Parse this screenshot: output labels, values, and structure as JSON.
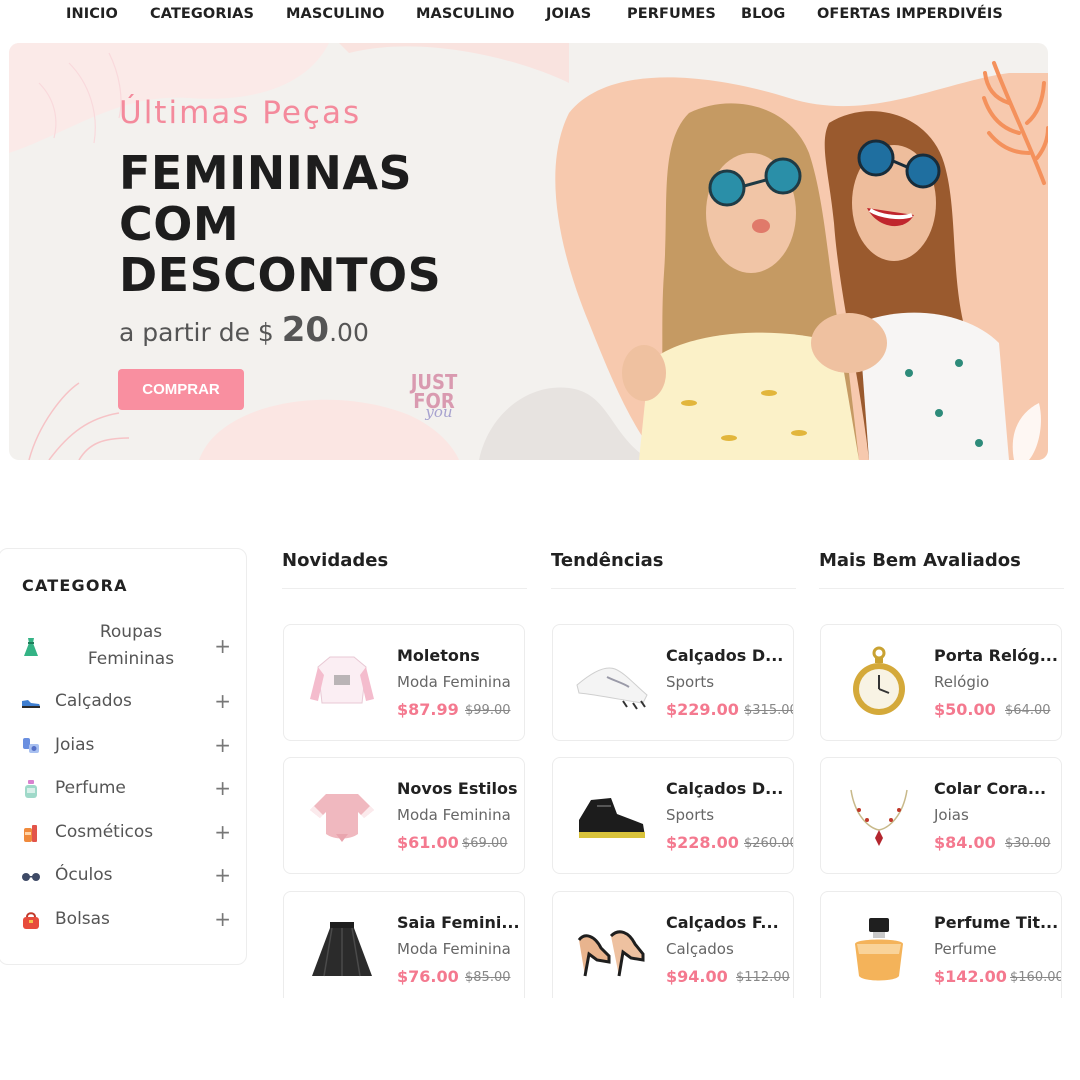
{
  "nav": {
    "items": [
      "INICIO",
      "CATEGORIAS",
      "MASCULINO",
      "MASCULINO",
      "JOIAS",
      "PERFUMES",
      "BLOG",
      "OFERTAS IMPERDIVÉIS"
    ]
  },
  "hero": {
    "subtitle": "Últimas Peças",
    "title_lines": [
      "FEMININAS",
      "COM",
      "DESCONTOS"
    ],
    "price_prefix": "a partir de $",
    "price_amount": "20",
    "price_cents": ".00",
    "button_label": "COMPRAR",
    "stamp_line1": "JUST",
    "stamp_line2": "FOR",
    "stamp_line3": "you"
  },
  "sidebar": {
    "title": "CATEGORA",
    "items": [
      {
        "label": "Roupas Femininas",
        "icon": "dress-icon"
      },
      {
        "label": "Calçados",
        "icon": "shoe-icon"
      },
      {
        "label": "Joias",
        "icon": "watch-icon"
      },
      {
        "label": "Perfume",
        "icon": "perfume-icon"
      },
      {
        "label": "Cosméticos",
        "icon": "cosmetics-icon"
      },
      {
        "label": "Óculos",
        "icon": "glasses-icon"
      },
      {
        "label": "Bolsas",
        "icon": "bag-icon"
      }
    ],
    "expand_symbol": "+"
  },
  "columns": [
    {
      "title": "Novidades",
      "products": [
        {
          "name": "Moletons",
          "category": "Moda Feminina",
          "price": "$87.99",
          "old_price": "$99.00",
          "image": "sweatshirt"
        },
        {
          "name": "Novos Estilos",
          "category": "Moda Feminina",
          "price": "$61.00",
          "old_price": "$69.00",
          "image": "crop-top"
        },
        {
          "name": "Saia Femini...",
          "category": "Moda Feminina",
          "price": "$76.00",
          "old_price": "$85.00",
          "image": "skirt"
        }
      ]
    },
    {
      "title": "Tendências",
      "products": [
        {
          "name": "Calçados D...",
          "category": "Sports",
          "price": "$229.00",
          "old_price": "$315.00",
          "image": "sneaker-white"
        },
        {
          "name": "Calçados D...",
          "category": "Sports",
          "price": "$228.00",
          "old_price": "$260.00",
          "image": "sneaker-black"
        },
        {
          "name": "Calçados F...",
          "category": "Calçados",
          "price": "$94.00",
          "old_price": "$112.00",
          "image": "heels"
        }
      ]
    },
    {
      "title": "Mais Bem Avaliados",
      "products": [
        {
          "name": "Porta Relóg...",
          "category": "Relógio",
          "price": "$50.00",
          "old_price": "$64.00",
          "image": "pocket-watch"
        },
        {
          "name": "Colar Cora...",
          "category": "Joias",
          "price": "$84.00",
          "old_price": "$30.00",
          "image": "necklace"
        },
        {
          "name": "Perfume Tit...",
          "category": "Perfume",
          "price": "$142.00",
          "old_price": "$160.00",
          "image": "perfume-bottle"
        }
      ]
    }
  ],
  "colors": {
    "accent": "#f4798f",
    "button": "#f98fa0",
    "hero_peach": "#f7c9ae",
    "text_dark": "#212121"
  }
}
